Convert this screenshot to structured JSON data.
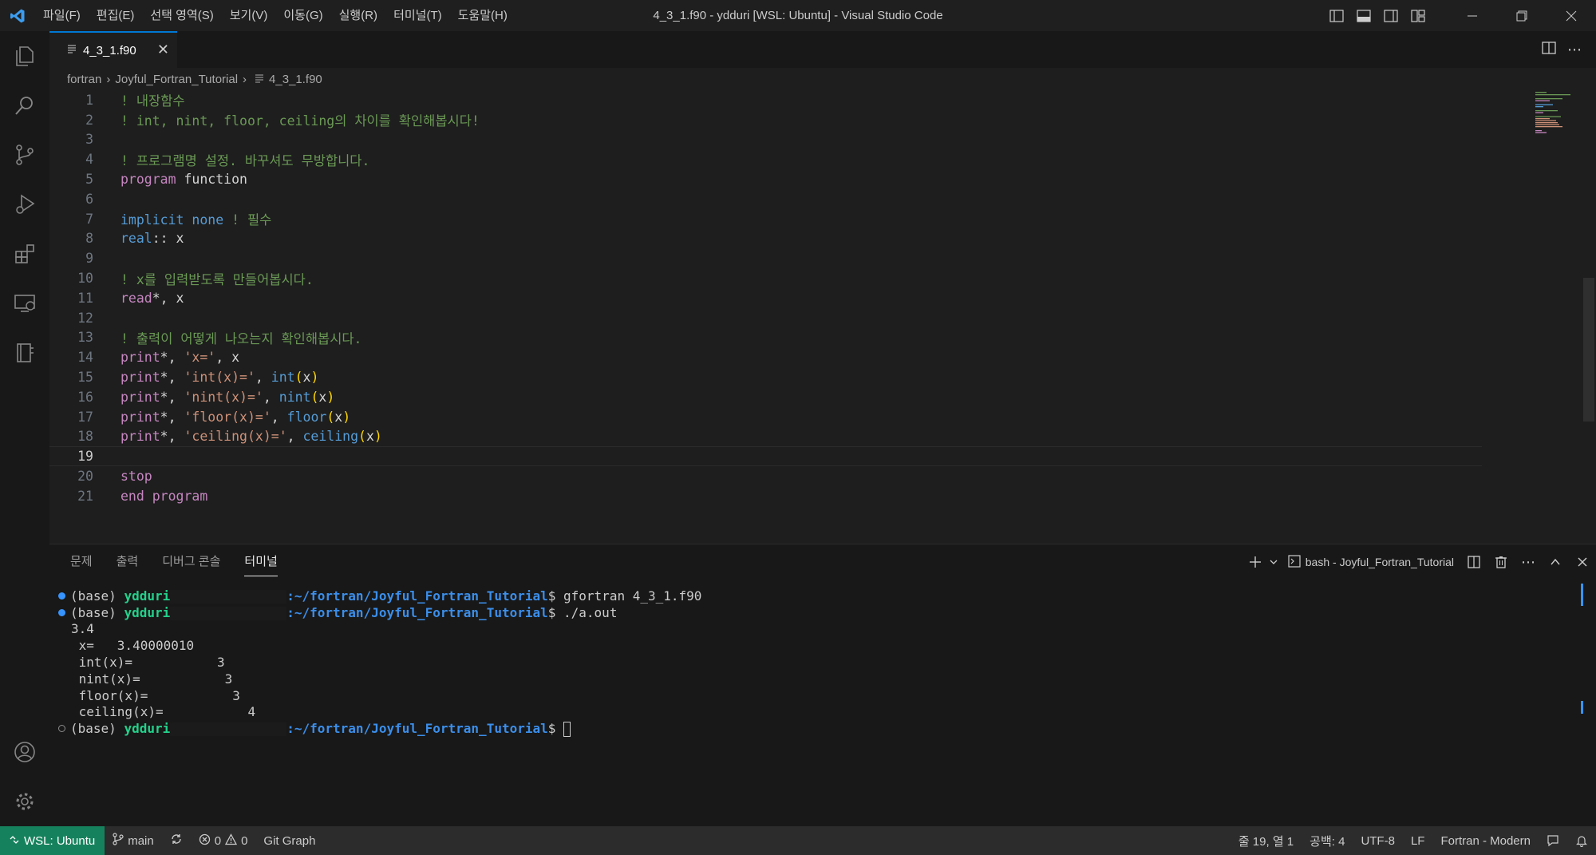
{
  "window": {
    "title": "4_3_1.f90 - ydduri [WSL: Ubuntu] - Visual Studio Code",
    "menu": [
      "파일(F)",
      "편집(E)",
      "선택 영역(S)",
      "보기(V)",
      "이동(G)",
      "실행(R)",
      "터미널(T)",
      "도움말(H)"
    ],
    "accent_color": "#0078d4"
  },
  "activity_bar": {
    "items": [
      "explorer-icon",
      "search-icon",
      "source-control-icon",
      "run-debug-icon",
      "extensions-icon",
      "remote-explorer-icon",
      "notebook-icon"
    ],
    "bottom": [
      "account-icon",
      "settings-gear-icon"
    ]
  },
  "editor": {
    "tab_label": "4_3_1.f90",
    "breadcrumb": [
      "fortran",
      "Joyful_Fortran_Tutorial",
      "4_3_1.f90"
    ],
    "current_line": "19",
    "lines": [
      {
        "no": "1",
        "text": "! 내장함수"
      },
      {
        "no": "2",
        "text": "! int, nint, floor, ceiling의 차이를 확인해봅시다!"
      },
      {
        "no": "3",
        "text": ""
      },
      {
        "no": "4",
        "text": "! 프로그램명 설정. 바꾸셔도 무방합니다."
      },
      {
        "no": "5",
        "kw": "program",
        "rest": " function"
      },
      {
        "no": "6",
        "text": ""
      },
      {
        "no": "7",
        "kw": "implicit none",
        "comment": " ! 필수"
      },
      {
        "no": "8",
        "kw": "real",
        "rest": ":: x"
      },
      {
        "no": "9",
        "text": ""
      },
      {
        "no": "10",
        "text": "! x를 입력받도록 만들어봅시다."
      },
      {
        "no": "11",
        "kw": "read",
        "rest": "*, x"
      },
      {
        "no": "12",
        "text": ""
      },
      {
        "no": "13",
        "text": "! 출력이 어떻게 나오는지 확인해봅시다."
      },
      {
        "no": "14",
        "kw": "print",
        "rest": "*, ",
        "str": "'x='",
        "tail": ", x"
      },
      {
        "no": "15",
        "kw": "print",
        "rest": "*, ",
        "str": "'int(x)='",
        "fn": "int"
      },
      {
        "no": "16",
        "kw": "print",
        "rest": "*, ",
        "str": "'nint(x)='",
        "fn": "nint"
      },
      {
        "no": "17",
        "kw": "print",
        "rest": "*, ",
        "str": "'floor(x)='",
        "fn": "floor"
      },
      {
        "no": "18",
        "kw": "print",
        "rest": "*, ",
        "str": "'ceiling(x)='",
        "fn": "ceiling"
      },
      {
        "no": "19",
        "text": ""
      },
      {
        "no": "20",
        "kw": "stop"
      },
      {
        "no": "21",
        "kw": "end program"
      }
    ]
  },
  "panel": {
    "tabs": [
      "문제",
      "출력",
      "디버그 콘솔",
      "터미널"
    ],
    "active_tab": "터미널",
    "terminal_name": "bash - Joyful_Fortran_Tutorial",
    "terminal": {
      "prompt_env": "(base) ",
      "user": "ydduri",
      "path": ":~/fortran/Joyful_Fortran_Tutorial",
      "cmd1": "$ gfortran 4_3_1.f90",
      "cmd2": "$ ./a.out",
      "input": "3.4",
      "out1": " x=   3.40000010",
      "out2": " int(x)=           3",
      "out3": " nint(x)=           3",
      "out4": " floor(x)=           3",
      "out5": " ceiling(x)=           4",
      "cmd3": "$ "
    }
  },
  "status_bar": {
    "remote": "WSL: Ubuntu",
    "branch": "main",
    "errors": "0",
    "warnings": "0",
    "git_graph": "Git Graph",
    "position": "줄 19, 열 1",
    "spaces": "공백: 4",
    "encoding": "UTF-8",
    "eol": "LF",
    "language": "Fortran - Modern",
    "remote_color": "#16825d"
  }
}
